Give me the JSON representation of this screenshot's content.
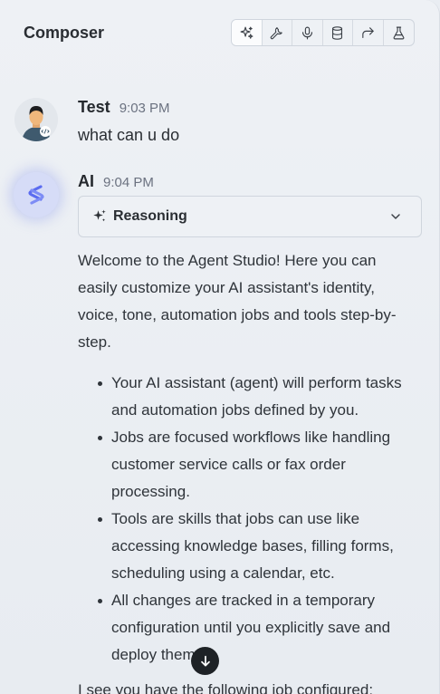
{
  "header": {
    "title": "Composer",
    "tools": [
      {
        "icon": "sparkles-icon",
        "active": true
      },
      {
        "icon": "wrench-icon",
        "active": false
      },
      {
        "icon": "microphone-icon",
        "active": false
      },
      {
        "icon": "database-icon",
        "active": false
      },
      {
        "icon": "redirect-arrow-icon",
        "active": false
      },
      {
        "icon": "flask-icon",
        "active": false
      }
    ]
  },
  "messages": [
    {
      "author": "Test",
      "time": "9:03 PM",
      "text": "what can u do"
    },
    {
      "author": "AI",
      "time": "9:04 PM"
    }
  ],
  "reasoning": {
    "label": "Reasoning"
  },
  "response": {
    "intro": "Welcome to the Agent Studio! Here you can easily customize your AI assistant's identity, voice, tone, automation jobs and tools step-by-step.",
    "bullets": [
      "Your AI assistant (agent) will perform tasks and automation jobs defined by you.",
      "Jobs are focused workflows like handling customer service calls or fax order processing.",
      "Tools are skills that jobs can use like accessing knowledge bases, filling forms, scheduling using a calendar, etc.",
      "All changes are tracked in a temporary configuration until you explicitly save and deploy them."
    ],
    "next_line": "I see you have the following job configured:"
  },
  "colors": {
    "accent_ai": "#5b6cf0",
    "background": "#e9edf2"
  }
}
